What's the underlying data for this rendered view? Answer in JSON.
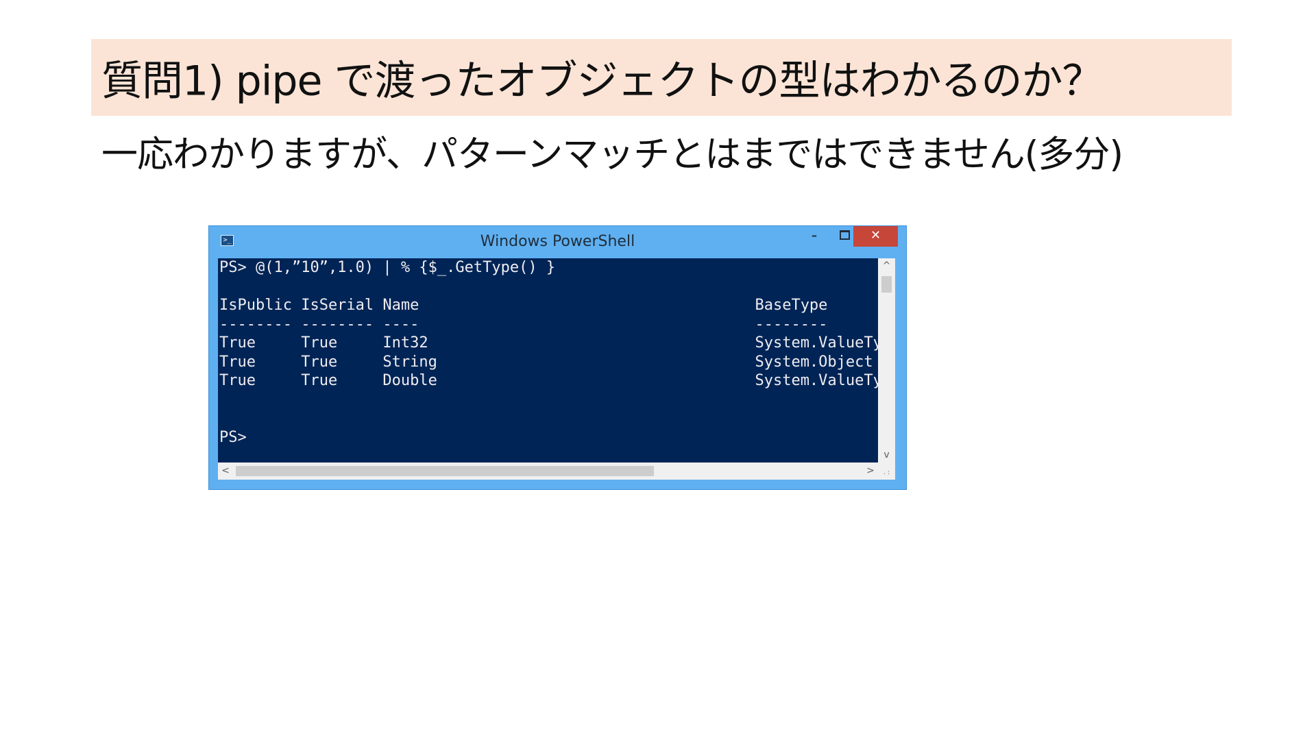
{
  "slide": {
    "title": "質問1) pipe で渡ったオブジェクトの型はわかるのか？",
    "subtitle": "一応わかりますが、パターンマッチとはまではできません(多分)"
  },
  "window": {
    "title": "Windows PowerShell",
    "app_icon_glyph": ">_",
    "minimize_glyph": "–",
    "close_glyph": "✕",
    "vscroll_up_glyph": "^",
    "vscroll_down_glyph": "v",
    "hscroll_left_glyph": "<",
    "hscroll_right_glyph": ">",
    "grip_glyph": ".:"
  },
  "console": {
    "text": "PS> @(1,”10”,1.0) | % {$_.GetType() }\n\nIsPublic IsSerial Name                                     BaseType\n-------- -------- ----                                     --------\nTrue     True     Int32                                    System.ValueType\nTrue     True     String                                   System.Object\nTrue     True     Double                                   System.ValueType\n\n\nPS>"
  },
  "colors": {
    "title_background": "#fbe4d6",
    "window_frame": "#5fb0f1",
    "console_background": "#012456",
    "console_foreground": "#eeedf0",
    "close_button": "#c7463a"
  }
}
